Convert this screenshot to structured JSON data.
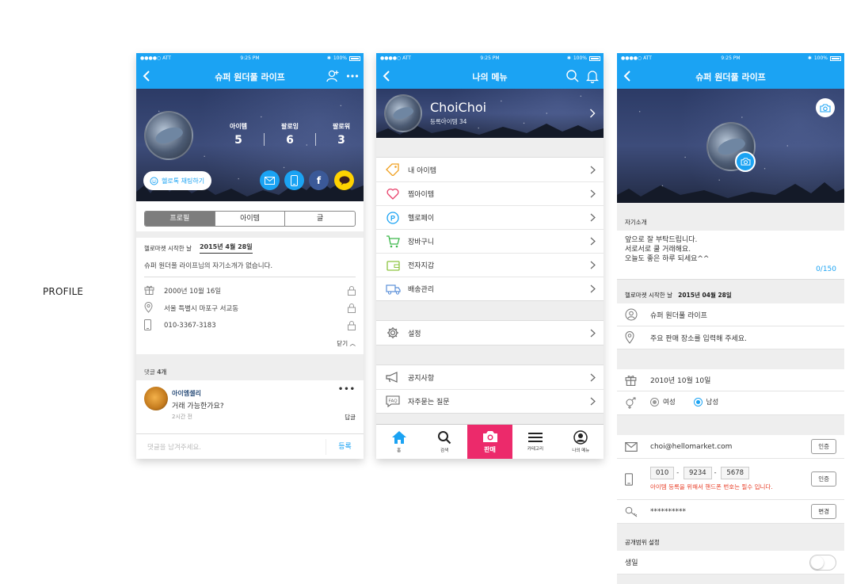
{
  "side_label": "PROFILE",
  "status": {
    "carrier": "●●●●○ ATT",
    "time": "9:25 PM",
    "battery": "100%"
  },
  "profile": {
    "title": "슈퍼 원더풀 라이프",
    "stats": [
      {
        "label": "아이템",
        "value": "5"
      },
      {
        "label": "팔로잉",
        "value": "6"
      },
      {
        "label": "팔로워",
        "value": "3"
      }
    ],
    "chat_button": "헬로톡 채팅하기",
    "tabs": [
      "프로필",
      "아이템",
      "글"
    ],
    "since_label": "헬로마켓 시작한 날",
    "since_date": "2015년 4월 28일",
    "intro": "슈퍼 원더풀 라이프님의 자기소개가 없습니다.",
    "birthday": "2000년 10월 16일",
    "address": "서울 특별시 마포구 서교동",
    "phone": "010-3367-3183",
    "close_label": "닫기",
    "comments_label": "댓글",
    "comments_count": "4개",
    "comment": {
      "name": "아이엠셀리",
      "text": "거래 가능한가요?",
      "time": "2시간 전",
      "reply": "답글"
    },
    "comment_placeholder": "댓글을 남겨주세요.",
    "submit": "등록"
  },
  "menu": {
    "title": "나의 메뉴",
    "user_name": "ChoiChoi",
    "user_sub": "등록아이템 34",
    "group1": [
      "내 아이템",
      "찜아이템",
      "헬로페이",
      "장바구니",
      "전자지갑",
      "배송관리"
    ],
    "group2": [
      "설정"
    ],
    "group3": [
      "공지사항",
      "자주묻는 질문"
    ],
    "faq_badge": "FAQ",
    "tabs": [
      "홈",
      "검색",
      "판매",
      "카테고리",
      "나의 메뉴"
    ]
  },
  "edit": {
    "title": "슈퍼 원더풀 라이프",
    "intro_header": "자기소개",
    "intro_lines": [
      "앞으로 잘 부탁드립니다.",
      "서로서로 쿨 거래해요.",
      "오늘도 좋은 하루 되세요^^"
    ],
    "intro_count": "0/150",
    "since_label": "헬로마켓 시작한 날",
    "since_date": "2015년 04월 28일",
    "nickname": "슈퍼 원더풀 라이프",
    "location_placeholder": "주요 판매 장소를 입력해 주세요.",
    "birthday": "2010년 10월 10일",
    "gender_female": "여성",
    "gender_male": "남성",
    "email": "choi@hellomarket.com",
    "verify": "인증",
    "phone_parts": [
      "010",
      "9234",
      "5678"
    ],
    "phone_dash": "-",
    "phone_warning": "아이템 등록을 위해서 핸드폰 번호는 필수 입니다.",
    "password": "**********",
    "change": "변경",
    "privacy_header": "공개범위 설정",
    "privacy_birthday": "생일"
  },
  "colors": {
    "brand": "#1ba3f3",
    "sell": "#ec2a6b",
    "kakao": "#ffd200",
    "facebook": "#3b5998"
  }
}
